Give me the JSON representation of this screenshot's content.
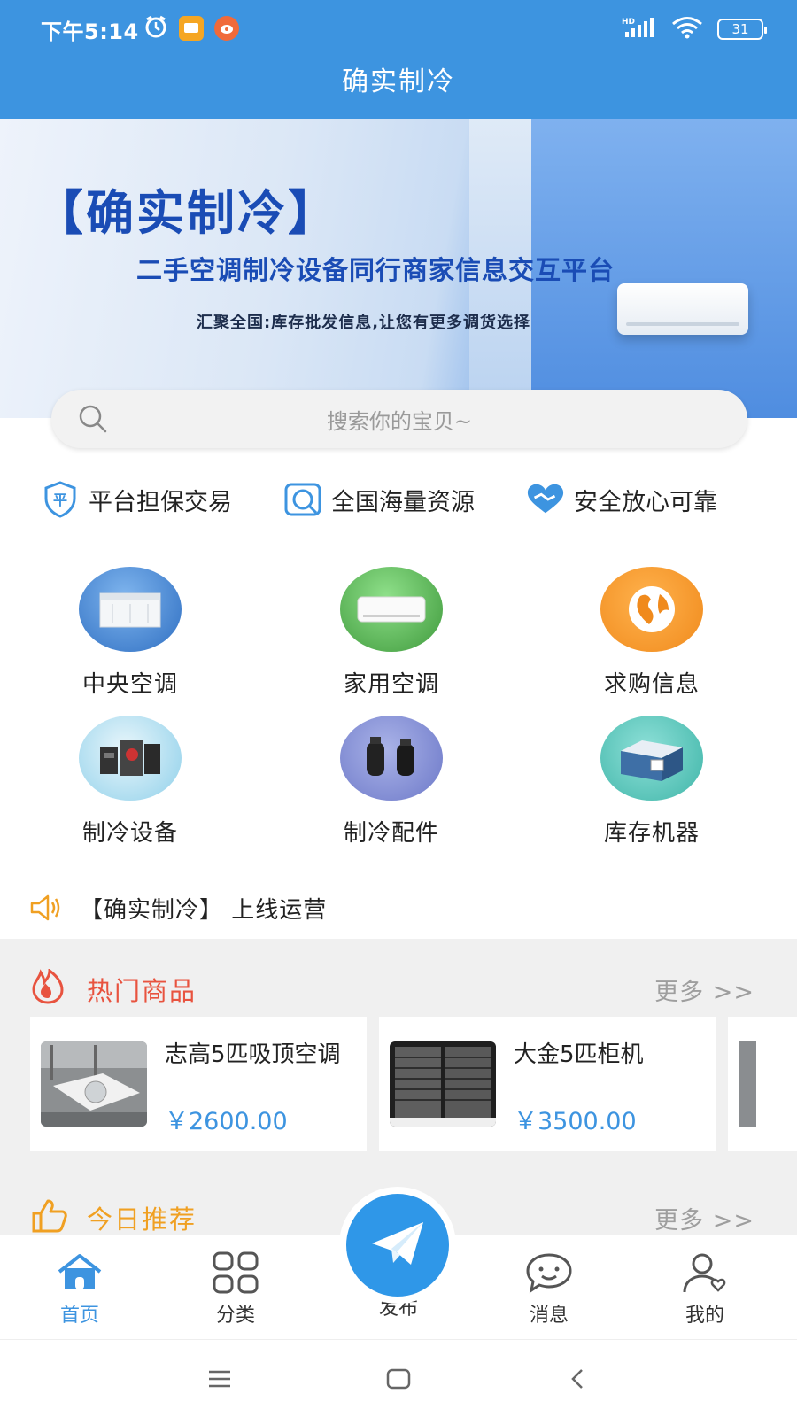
{
  "status_bar": {
    "time": "下午5:14",
    "battery": "31",
    "network": "HD"
  },
  "header": {
    "title": "确实制冷"
  },
  "banner": {
    "title": "【确实制冷】",
    "subtitle": "二手空调制冷设备同行商家信息交互平台",
    "tagline": "汇聚全国:库存批发信息,让您有更多调货选择"
  },
  "search": {
    "placeholder": "搜索你的宝贝~"
  },
  "features": [
    {
      "label": "平台担保交易",
      "icon": "shield-icon"
    },
    {
      "label": "全国海量资源",
      "icon": "magnifier-icon"
    },
    {
      "label": "安全放心可靠",
      "icon": "handshake-icon"
    }
  ],
  "categories": [
    {
      "label": "中央空调",
      "icon": "central-ac-icon"
    },
    {
      "label": "家用空调",
      "icon": "home-ac-icon"
    },
    {
      "label": "求购信息",
      "icon": "globe-icon"
    },
    {
      "label": "制冷设备",
      "icon": "refrigeration-equipment-icon"
    },
    {
      "label": "制冷配件",
      "icon": "compressor-icon"
    },
    {
      "label": "库存机器",
      "icon": "warehouse-icon"
    }
  ],
  "notice": {
    "text": "【确实制冷】 上线运营"
  },
  "hot": {
    "title": "热门商品",
    "more": "更多 >>",
    "items": [
      {
        "name": "志高5匹吸顶空调",
        "price": "￥2600.00"
      },
      {
        "name": "大金5匹柜机",
        "price": "￥3500.00"
      }
    ]
  },
  "recommend": {
    "title": "今日推荐",
    "more": "更多 >>"
  },
  "tabbar": {
    "home": "首页",
    "category": "分类",
    "publish": "发布",
    "messages": "消息",
    "mine": "我的"
  },
  "colors": {
    "primary": "#3d94e0",
    "hot": "#e8533f",
    "recommend": "#f0a022"
  }
}
